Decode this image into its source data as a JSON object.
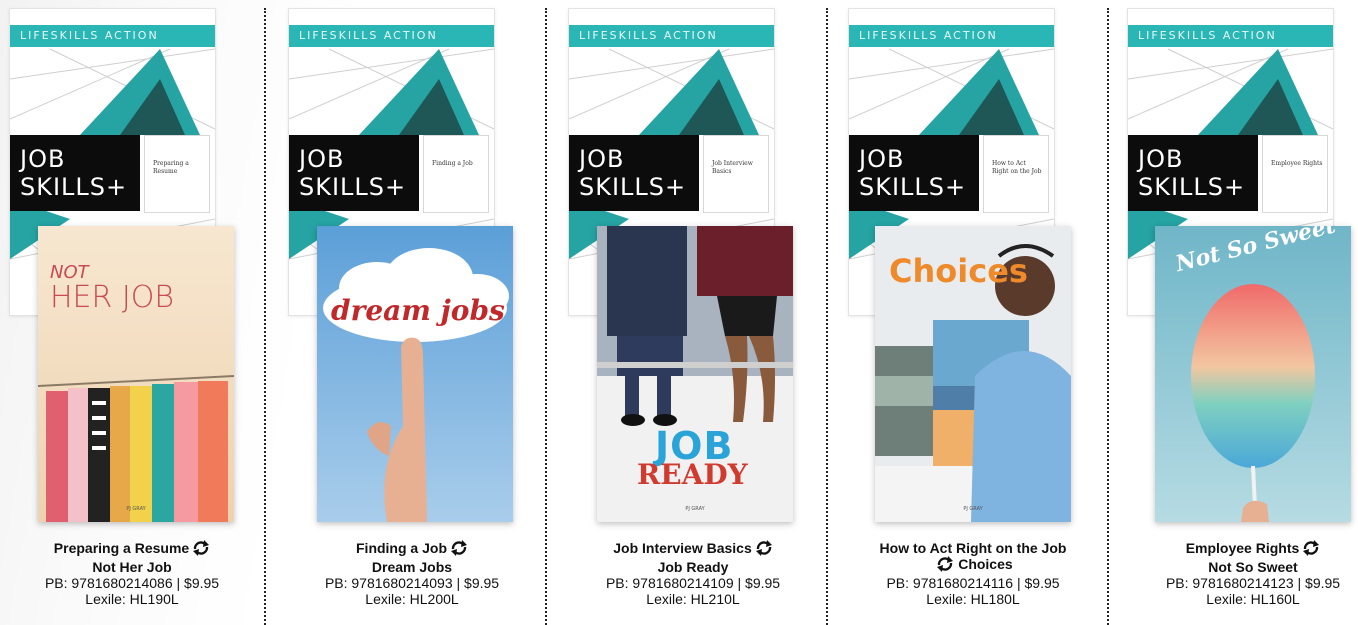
{
  "series": {
    "label": "LIFESKILLS   ACTION",
    "title": "JOB\nSKILLS+",
    "accent": "#2bb6b6"
  },
  "items": [
    {
      "topic": "Preparing a Resume",
      "series_subtitle": "Preparing a Resume",
      "book_title": "Not Her Job",
      "cover_text_1": "NOT",
      "cover_text_2": "HER JOB",
      "author": "PJ GRAY",
      "isbn_line": "PB: 9781680214086 | $9.95",
      "lexile": "Lexile: HL190L"
    },
    {
      "topic": "Finding a Job",
      "series_subtitle": "Finding a Job",
      "book_title": "Dream Jobs",
      "cover_text_1": "dream jobs",
      "cover_text_2": "",
      "author": "PJ GRAY",
      "isbn_line": "PB: 9781680214093 | $9.95",
      "lexile": "Lexile: HL200L"
    },
    {
      "topic": "Job Interview Basics",
      "series_subtitle": "Job Interview Basics",
      "book_title": "Job Ready",
      "cover_text_1": "JOB",
      "cover_text_2": "READY",
      "author": "PJ GRAY",
      "isbn_line": "PB: 9781680214109 | $9.95",
      "lexile": "Lexile: HL210L"
    },
    {
      "topic": "How to Act Right on the Job",
      "series_subtitle": "How to Act Right on the Job",
      "book_title": "Choices",
      "cover_text_1": "Choices",
      "cover_text_2": "",
      "author": "PJ GRAY",
      "isbn_line": "PB: 9781680214116 | $9.95",
      "lexile": "Lexile: HL180L"
    },
    {
      "topic": "Employee Rights",
      "series_subtitle": "Employee Rights",
      "book_title": "Not So Sweet",
      "cover_text_1": "Not So Sweet",
      "cover_text_2": "",
      "author": "PJ GRAY",
      "isbn_line": "PB: 9781680214123 | $9.95",
      "lexile": "Lexile: HL160L"
    }
  ],
  "icons": {
    "swap": "swap-arrows-icon"
  }
}
